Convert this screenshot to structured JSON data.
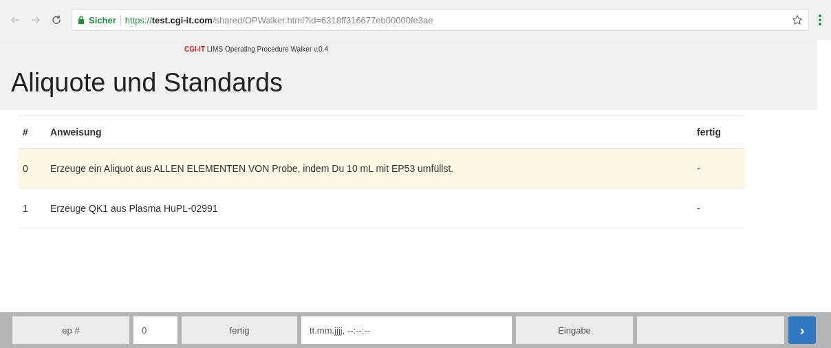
{
  "browser": {
    "security_label": "Sicher",
    "url_scheme": "https://",
    "url_host": "test.cgi-it.com",
    "url_path": "/shared/OPWalker.html?id=6318ff316677eb00000fe3ae"
  },
  "header": {
    "brand": "CGI-IT",
    "app_name": "LIMS Operating Procedure Walker v.0.4",
    "title": "Aliquote und Standards"
  },
  "table": {
    "columns": [
      "#",
      "Anweisung",
      "fertig"
    ],
    "rows": [
      {
        "cells": [
          "0",
          "Erzeuge ein Aliquot aus ALLEN ELEMENTEN VON Probe, indem Du 10 mL mit EP53 umfüllst.",
          "-"
        ],
        "selected": true
      },
      {
        "cells": [
          "1",
          "Erzeuge QK1 aus Plasma HuPL-02991",
          "-"
        ],
        "selected": false
      }
    ]
  },
  "footer": {
    "step_label": "ep #",
    "step_value": "0",
    "done_label": "fertig",
    "date_placeholder": "tt.mm.jjjj, --:--:--",
    "input_label": "Eingabe",
    "next_button": "›"
  }
}
